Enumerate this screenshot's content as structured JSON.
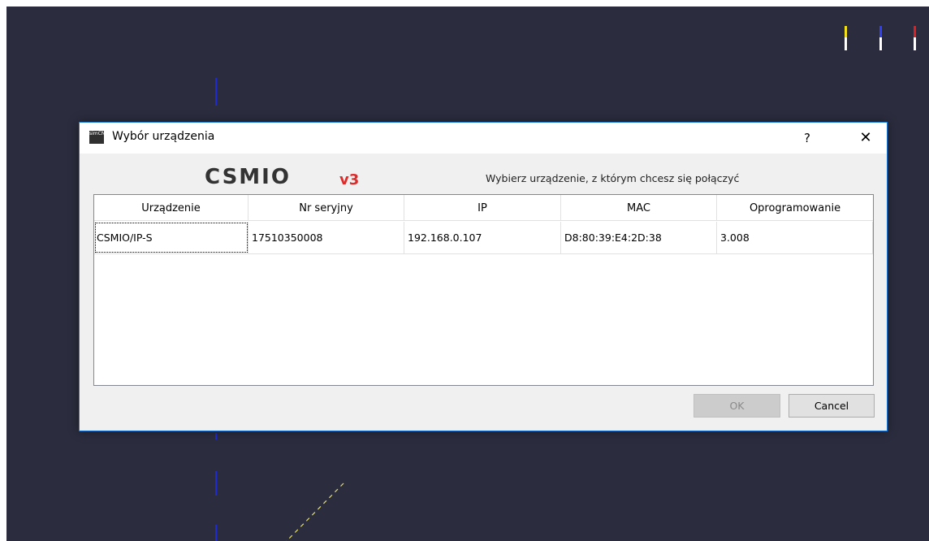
{
  "dialog": {
    "title": "Wybór urządzenia",
    "help_label": "?",
    "close_label": "✕",
    "app_icon_text": "simCNC",
    "logo_text": "CSMIO",
    "logo_badge": "v3",
    "prompt": "Wybierz urządzenie, z którym chcesz się połączyć",
    "ok_label": "OK",
    "cancel_label": "Cancel"
  },
  "table": {
    "columns": [
      "Urządzenie",
      "Nr seryjny",
      "IP",
      "MAC",
      "Oprogramowanie"
    ],
    "rows": [
      [
        "CSMIO/IP-S",
        "17510350008",
        "192.168.0.107",
        "D8:80:39:E4:2D:38",
        "3.008"
      ]
    ]
  },
  "colors": {
    "viewport_bg": "#2b2d3f",
    "dialog_border": "#1a7bd6",
    "axis_blue": "#1e2bd0",
    "marker_yellow": "#f5e11a",
    "marker_red": "#e02020",
    "logo_red": "#e02a2a"
  }
}
